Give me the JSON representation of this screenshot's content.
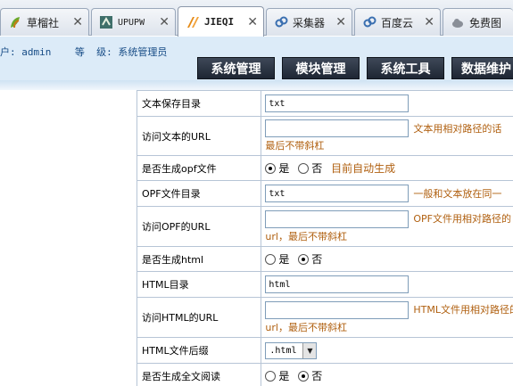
{
  "browser_tabs": [
    {
      "label": "草榴社",
      "icon": "leaf-icon",
      "active": false
    },
    {
      "label": "UPUPW",
      "icon": "upupw-icon",
      "active": false
    },
    {
      "label": "JIEQI",
      "icon": "jieqi-icon",
      "active": true
    },
    {
      "label": "采集器",
      "icon": "link-icon",
      "active": false
    },
    {
      "label": "百度云",
      "icon": "link-icon",
      "active": false
    },
    {
      "label": "免费图",
      "icon": "cloud-icon",
      "active": false
    }
  ],
  "header": {
    "user_line": "户: admin    等  级: 系统管理员",
    "nav": [
      "系统管理",
      "模块管理",
      "系统工具",
      "数据维护"
    ]
  },
  "form": {
    "rows": [
      {
        "label": "文本保存目录",
        "type": "text",
        "value": "txt",
        "hint": "",
        "hint2": ""
      },
      {
        "label": "访问文本的URL",
        "type": "text",
        "value": "",
        "hint": "文本用相对路径的话",
        "hint2": "最后不带斜杠"
      },
      {
        "label": "是否生成opf文件",
        "type": "radio",
        "options": [
          "是",
          "否"
        ],
        "selected": 0,
        "hint": "目前自动生成"
      },
      {
        "label": "OPF文件目录",
        "type": "text",
        "value": "txt",
        "hint": "一般和文本放在同一",
        "hint2": ""
      },
      {
        "label": "访问OPF的URL",
        "type": "text",
        "value": "",
        "hint": "OPF文件用相对路径的",
        "hint2": "url，最后不带斜杠"
      },
      {
        "label": "是否生成html",
        "type": "radio",
        "options": [
          "是",
          "否"
        ],
        "selected": 1,
        "hint": ""
      },
      {
        "label": "HTML目录",
        "type": "text",
        "value": "html",
        "hint": "",
        "hint2": ""
      },
      {
        "label": "访问HTML的URL",
        "type": "text",
        "value": "",
        "hint": "HTML文件用相对路径的",
        "hint2": "url，最后不带斜杠"
      },
      {
        "label": "HTML文件后缀",
        "type": "select",
        "value": ".html"
      },
      {
        "label": "是否生成全文阅读",
        "type": "radio",
        "options": [
          "是",
          "否"
        ],
        "selected": 1,
        "hint": ""
      }
    ]
  }
}
